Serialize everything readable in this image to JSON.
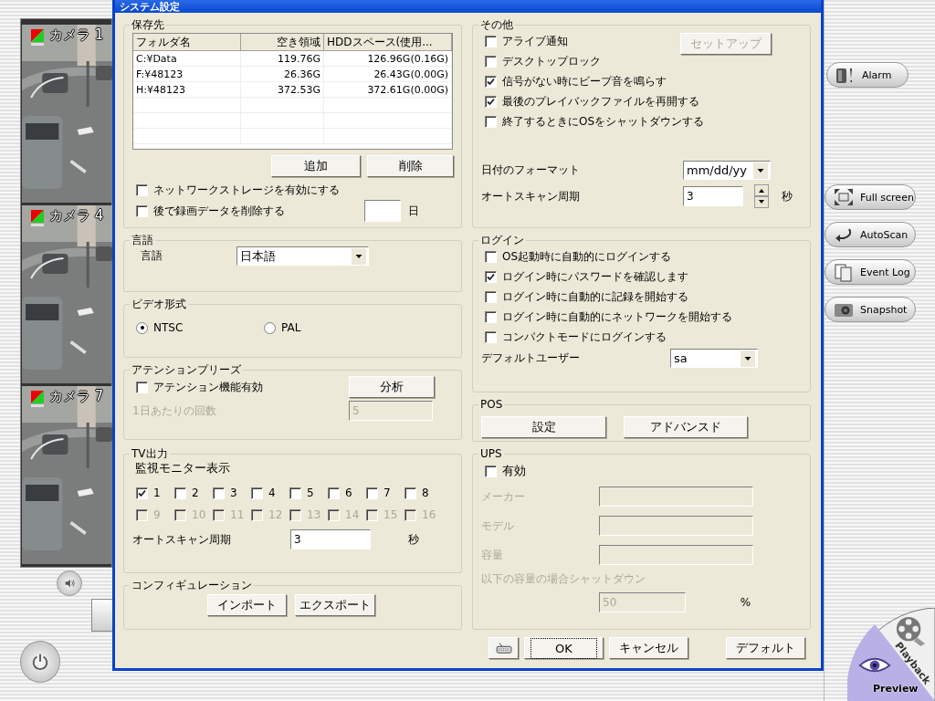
{
  "app": {
    "cameras": [
      {
        "label": "カメラ 1"
      },
      {
        "label": "カメラ 4"
      },
      {
        "label": "カメラ 7"
      }
    ],
    "side_buttons": [
      {
        "label": "Alarm",
        "kind": "alarm"
      },
      {
        "label": "Full screen",
        "kind": "fullscreen"
      },
      {
        "label": "AutoScan",
        "kind": "autoscan"
      },
      {
        "label": "Event Log",
        "kind": "eventlog"
      },
      {
        "label": "Snapshot",
        "kind": "snapshot"
      }
    ],
    "mode_tabs": [
      {
        "label": "Playback",
        "kind": "playback",
        "selected": false
      },
      {
        "label": "Preview",
        "kind": "preview",
        "selected": true
      }
    ]
  },
  "dialog": {
    "title": "システム設定",
    "storage": {
      "title": "保存先",
      "columns": [
        "フォルダ名",
        "空き領域",
        "HDDスペース(使用..."
      ],
      "rows": [
        [
          "C:¥Data",
          "119.76G",
          "126.96G(0.16G)"
        ],
        [
          "F:¥48123",
          "26.36G",
          "26.43G(0.00G)"
        ],
        [
          "H:¥48123",
          "372.53G",
          "372.61G(0.00G)"
        ]
      ],
      "buttons": [
        "追加",
        "削除"
      ],
      "network_storage": {
        "label": "ネットワークストレージを有効にする",
        "checked": false
      },
      "delete_later": {
        "label": "後で録画データを削除する",
        "checked": false,
        "unit": "日"
      }
    },
    "language": {
      "title": "言語",
      "label": "言語",
      "value": "日本語"
    },
    "video_format": {
      "title": "ビデオ形式",
      "options": [
        {
          "label": "NTSC",
          "selected": true
        },
        {
          "label": "PAL",
          "selected": false
        }
      ]
    },
    "attention": {
      "title": "アテンションプリーズ",
      "enable": {
        "label": "アテンション機能有効",
        "checked": false
      },
      "button": "分析",
      "count_label": "1日あたりの回数",
      "count": "5",
      "disabled": true
    },
    "tv_output": {
      "title": "TV出力",
      "monitor_label": "監視モニター表示",
      "monitors": [
        {
          "label": "1",
          "checked": true,
          "disabled": false
        },
        {
          "label": "2",
          "checked": false,
          "disabled": false
        },
        {
          "label": "3",
          "checked": false,
          "disabled": false
        },
        {
          "label": "4",
          "checked": false,
          "disabled": false
        },
        {
          "label": "5",
          "checked": false,
          "disabled": false
        },
        {
          "label": "6",
          "checked": false,
          "disabled": false
        },
        {
          "label": "7",
          "checked": false,
          "disabled": false
        },
        {
          "label": "8",
          "checked": false,
          "disabled": false
        },
        {
          "label": "9",
          "checked": false,
          "disabled": true
        },
        {
          "label": "10",
          "checked": false,
          "disabled": true
        },
        {
          "label": "11",
          "checked": false,
          "disabled": true
        },
        {
          "label": "12",
          "checked": false,
          "disabled": true
        },
        {
          "label": "13",
          "checked": false,
          "disabled": true
        },
        {
          "label": "14",
          "checked": false,
          "disabled": true
        },
        {
          "label": "15",
          "checked": false,
          "disabled": true
        },
        {
          "label": "16",
          "checked": false,
          "disabled": true
        }
      ],
      "scan_label": "オートスキャン周期",
      "scan_value": "3",
      "scan_unit": "秒"
    },
    "configuration": {
      "title": "コンフィギュレーション",
      "buttons": [
        "インポート",
        "エクスポート"
      ]
    },
    "other": {
      "title": "その他",
      "options": [
        {
          "label": "アライブ通知",
          "checked": false
        },
        {
          "label": "デスクトップロック",
          "checked": false
        },
        {
          "label": "信号がない時にビープ音を鳴らす",
          "checked": true
        },
        {
          "label": "最後のプレイバックファイルを再開する",
          "checked": true
        },
        {
          "label": "終了するときにOSをシャットダウンする",
          "checked": false
        }
      ],
      "setup_button": {
        "label": "セットアップ",
        "disabled": true
      },
      "date_format_label": "日付のフォーマット",
      "date_format": "mm/dd/yy",
      "scan_label": "オートスキャン周期",
      "scan_value": "3",
      "scan_unit": "秒"
    },
    "login": {
      "title": "ログイン",
      "options": [
        {
          "label": "OS起動時に自動的にログインする",
          "checked": false
        },
        {
          "label": "ログイン時にパスワードを確認します",
          "checked": true
        },
        {
          "label": "ログイン時に自動的に記録を開始する",
          "checked": false
        },
        {
          "label": "ログイン時に自動的にネットワークを開始する",
          "checked": false
        },
        {
          "label": "コンパクトモードにログインする",
          "checked": false
        }
      ],
      "default_user_label": "デフォルトユーザー",
      "default_user": "sa"
    },
    "pos": {
      "title": "POS",
      "buttons": [
        "設定",
        "アドバンスド"
      ]
    },
    "ups": {
      "title": "UPS",
      "enable": {
        "label": "有効",
        "checked": false
      },
      "disabled": true,
      "fields": [
        {
          "label": "メーカー"
        },
        {
          "label": "モデル"
        },
        {
          "label": "容量"
        }
      ],
      "threshold_label": "以下の容量の場合シャットダウン",
      "threshold": "50",
      "threshold_unit": "%"
    },
    "footer_buttons": [
      {
        "kind": "keyboard"
      },
      {
        "kind": "text",
        "label": "OK",
        "focused": true
      },
      {
        "kind": "text",
        "label": "キャンセル",
        "focused": false
      },
      {
        "kind": "text",
        "label": "デフォルト",
        "focused": false
      }
    ]
  }
}
